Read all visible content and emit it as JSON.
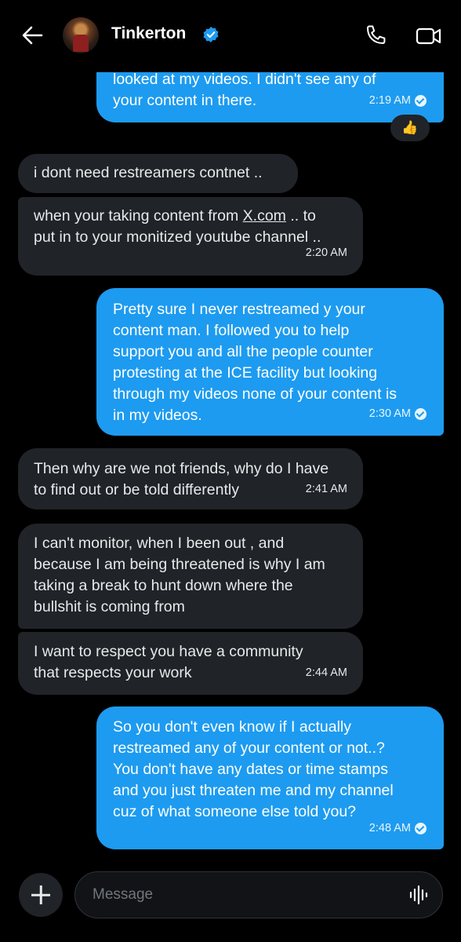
{
  "header": {
    "contact_name": "Tinkerton",
    "verified": true,
    "icons": [
      "back-arrow-icon",
      "avatar",
      "verified-badge-icon",
      "phone-icon",
      "video-camera-icon"
    ]
  },
  "messages": [
    {
      "dir": "out",
      "text": "looked at my videos. I didn't see any of\nyour content in there.",
      "time": "2:19 AM",
      "reaction": "👍"
    },
    {
      "dir": "in",
      "text": "i dont need restreamers contnet .."
    },
    {
      "dir": "in",
      "text_before": "when your taking content from ",
      "link": "X.com",
      "text_after": " .. to\nput in to your monitized youtube channel ..",
      "time": "2:20 AM"
    },
    {
      "dir": "out",
      "text": "Pretty sure I never restreamed y your\ncontent man. I followed you to help\nsupport you and all the people counter\nprotesting at the ICE facility but looking\nthrough my videos none of your content is\nin my videos.",
      "time": "2:30 AM"
    },
    {
      "dir": "in",
      "text": "Then why are we not friends, why do I have\nto find out or be told differently",
      "time": "2:41 AM"
    },
    {
      "dir": "in",
      "text": "I can't monitor, when I been out , and\nbecause I am being threatened is why I am\ntaking a break to hunt down where the\nbullshit is coming from"
    },
    {
      "dir": "in",
      "text": "I want to respect you have a community\nthat respects your work",
      "time": "2:44 AM"
    },
    {
      "dir": "out",
      "text": "So you don't even know if I actually\nrestreamed any of your content or not..?\nYou don't have any dates or time stamps\nand you just threaten me and my channel\ncuz of what someone else told you?",
      "time": "2:48 AM"
    }
  ],
  "composer": {
    "placeholder": "Message",
    "value": "",
    "icons": [
      "plus-icon",
      "voice-waveform-icon"
    ]
  },
  "colors": {
    "background": "#000000",
    "outgoing_bubble": "#1d9bf0",
    "incoming_bubble": "#202327",
    "verified_badge": "#1d9bf0"
  }
}
